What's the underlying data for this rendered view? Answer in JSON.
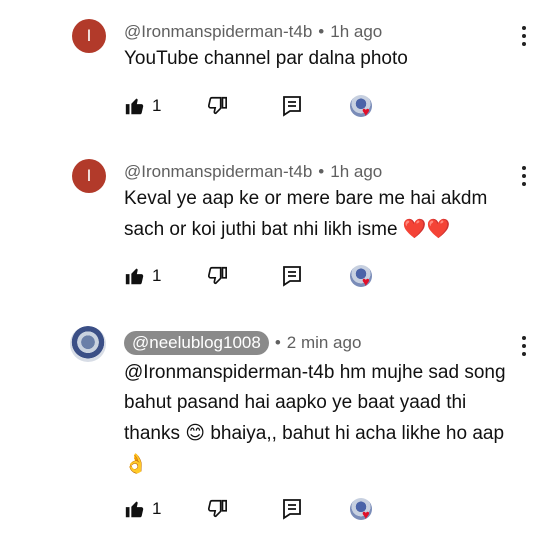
{
  "comments": [
    {
      "avatar_letter": "I",
      "handle": "@Ironmanspiderman-t4b",
      "time": "1h ago",
      "text": "YouTube channel par dalna photo",
      "likes": "1"
    },
    {
      "avatar_letter": "I",
      "handle": "@Ironmanspiderman-t4b",
      "time": "1h ago",
      "text": "Keval ye aap ke or mere bare me hai akdm sach or koi juthi bat nhi likh isme",
      "text_emoji": "❤️❤️",
      "likes": "1"
    },
    {
      "handle": "@neelublog1008",
      "time": "2 min ago",
      "text_part1": "@Ironmanspiderman-t4b hm mujhe sad song bahut pasand hai aapko ye baat yaad thi thanks",
      "emoji1": "😊",
      "text_part2": "bhaiya,, bahut hi acha likhe ho aap",
      "emoji2": "👌",
      "likes": "1"
    }
  ],
  "separator": "•",
  "icons": [
    "like-icon",
    "dislike-icon",
    "reply-icon",
    "creator-heart-icon",
    "more-options-icon"
  ],
  "colors": {
    "avatar_letter_bg": "#b23a2a",
    "heart": "#e0102a",
    "pill_bg": "#8a8a8a"
  }
}
